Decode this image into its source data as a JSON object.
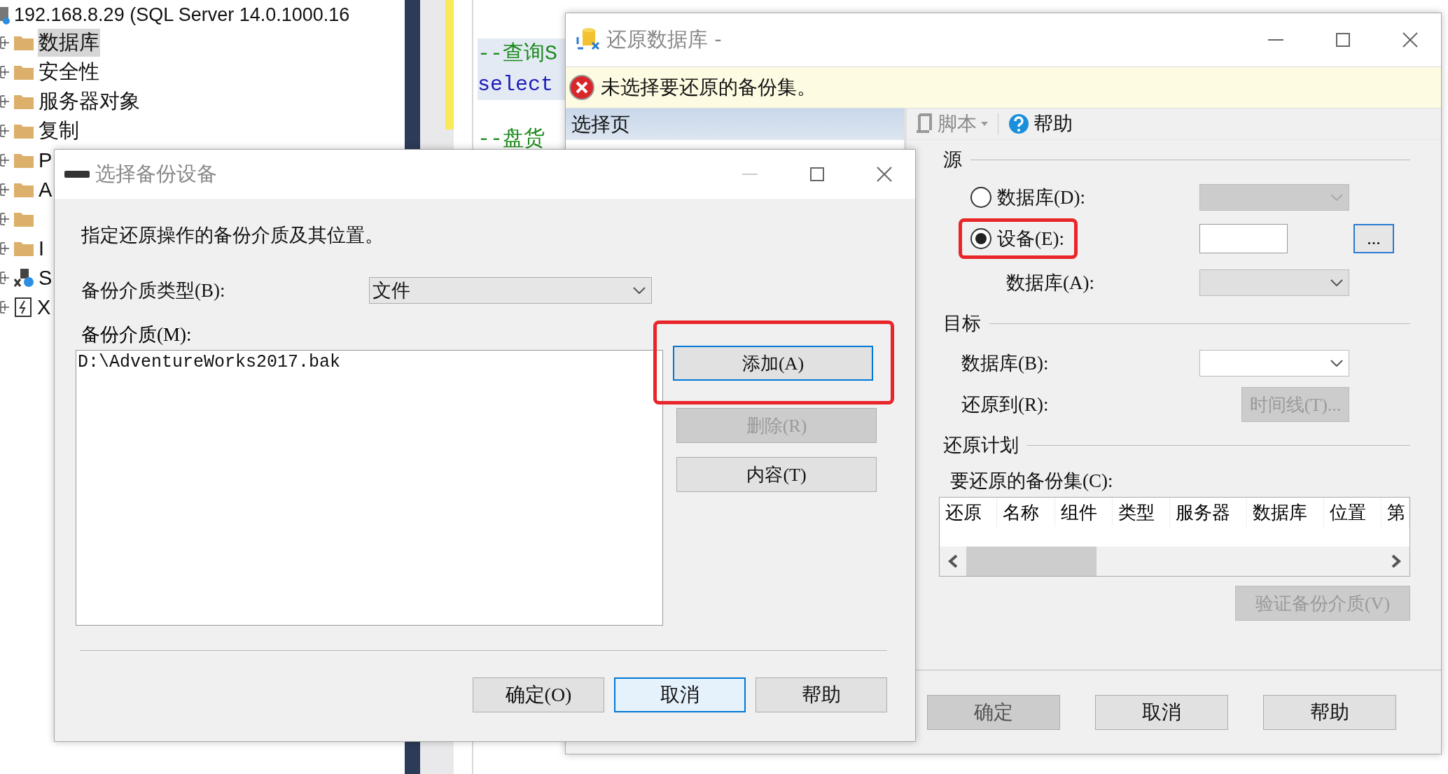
{
  "object_explorer": {
    "server": "192.168.8.29 (SQL Server 14.0.1000.16",
    "nodes": [
      {
        "label": "数据库",
        "kind": "folder",
        "selected": true
      },
      {
        "label": "安全性",
        "kind": "folder",
        "selected": false
      },
      {
        "label": "服务器对象",
        "kind": "folder",
        "selected": false
      },
      {
        "label": "复制",
        "kind": "folder",
        "selected": false
      },
      {
        "label": "P",
        "kind": "folder",
        "selected": false
      },
      {
        "label": "A",
        "kind": "folder",
        "selected": false
      },
      {
        "kind": "folder",
        "selected": false
      },
      {
        "label": "I",
        "kind": "folder",
        "selected": false
      },
      {
        "label": "S",
        "kind": "agent",
        "selected": false
      },
      {
        "label": "X",
        "kind": "profiler",
        "selected": false
      }
    ]
  },
  "editor": {
    "lines": [
      {
        "text": "--查询S",
        "kind": "comment"
      },
      {
        "text": "select",
        "kind": "keyword"
      },
      {
        "text": "--盘货",
        "kind": "comment"
      }
    ]
  },
  "restore_dialog": {
    "title": "还原数据库 -",
    "error": "未选择要还原的备份集。",
    "page_header": "选择页",
    "toolbar": [
      {
        "label": "脚本",
        "kind": "script",
        "disabled": true
      },
      {
        "label": "帮助",
        "kind": "help",
        "disabled": false
      }
    ],
    "source": {
      "title": "源",
      "options": [
        {
          "label": "数据库(D):",
          "selected": false,
          "highlighted": false
        },
        {
          "label": "设备(E):",
          "selected": true,
          "highlighted": true
        }
      ],
      "browse_button": "...",
      "database_label": "数据库(A):"
    },
    "target": {
      "title": "目标",
      "database_label": "数据库(B):",
      "restore_to_label": "还原到(R):",
      "timeline_button": "时间线(T)..."
    },
    "plan": {
      "title": "还原计划",
      "grid_label": "要还原的备份集(C):",
      "columns": [
        "还原",
        "名称",
        "组件",
        "类型",
        "服务器",
        "数据库",
        "位置",
        "第"
      ]
    },
    "verify_button": "验证备份介质(V)",
    "buttons": [
      {
        "label": "确定",
        "disabled": true
      },
      {
        "label": "取消",
        "disabled": false
      },
      {
        "label": "帮助",
        "disabled": false
      }
    ]
  },
  "select_device_dialog": {
    "title": "选择备份设备",
    "description": "指定还原操作的备份介质及其位置。",
    "media_type_label": "备份介质类型(B):",
    "media_type_value": "文件",
    "media_label": "备份介质(M):",
    "media_items": [
      "D:\\AdventureWorks2017.bak"
    ],
    "side_buttons": [
      {
        "label": "添加(A)",
        "disabled": false,
        "highlighted": true
      },
      {
        "label": "删除(R)",
        "disabled": true,
        "highlighted": false
      },
      {
        "label": "内容(T)",
        "disabled": false,
        "highlighted": false
      }
    ],
    "buttons": [
      {
        "label": "确定(O)",
        "default": false
      },
      {
        "label": "取消",
        "default": true
      },
      {
        "label": "帮助",
        "default": false
      }
    ]
  }
}
